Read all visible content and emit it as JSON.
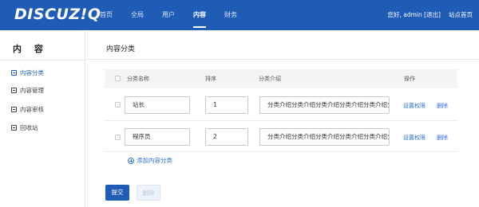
{
  "header": {
    "logo": "DISCUZ!Q",
    "nav": [
      "首页",
      "全局",
      "用户",
      "内容",
      "财务"
    ],
    "active_nav": 3,
    "greeting": "您好, admin [退出]",
    "site_home": "站点首页"
  },
  "sidebar": {
    "title": "内 容",
    "items": [
      {
        "label": "内容分类",
        "icon": "category-icon",
        "active": true
      },
      {
        "label": "内容管理",
        "icon": "document-icon",
        "active": false
      },
      {
        "label": "内容审核",
        "icon": "review-icon",
        "active": false
      },
      {
        "label": "回收站",
        "icon": "recycle-bin-icon",
        "active": false
      }
    ]
  },
  "main": {
    "title": "内容分类",
    "columns": {
      "name": "分类名称",
      "order": "排序",
      "desc": "分类介绍",
      "actions": "操作"
    },
    "rows": [
      {
        "name": "站长",
        "order": "1",
        "desc": "分类介绍分类介绍分类介绍分类介绍分类介绍分类介绍",
        "perm_label": "设置权限",
        "delete_label": "删除"
      },
      {
        "name": "程序员",
        "order": "2",
        "desc": "分类介绍分类介绍分类介绍分类介绍分类介绍分类介绍",
        "perm_label": "设置权限",
        "delete_label": "删除"
      }
    ],
    "add_label": "添加内容分类",
    "submit_label": "提交",
    "delete_label": "删除"
  },
  "colors": {
    "brand": "#1f5cb6",
    "link": "#2d6fd2"
  }
}
